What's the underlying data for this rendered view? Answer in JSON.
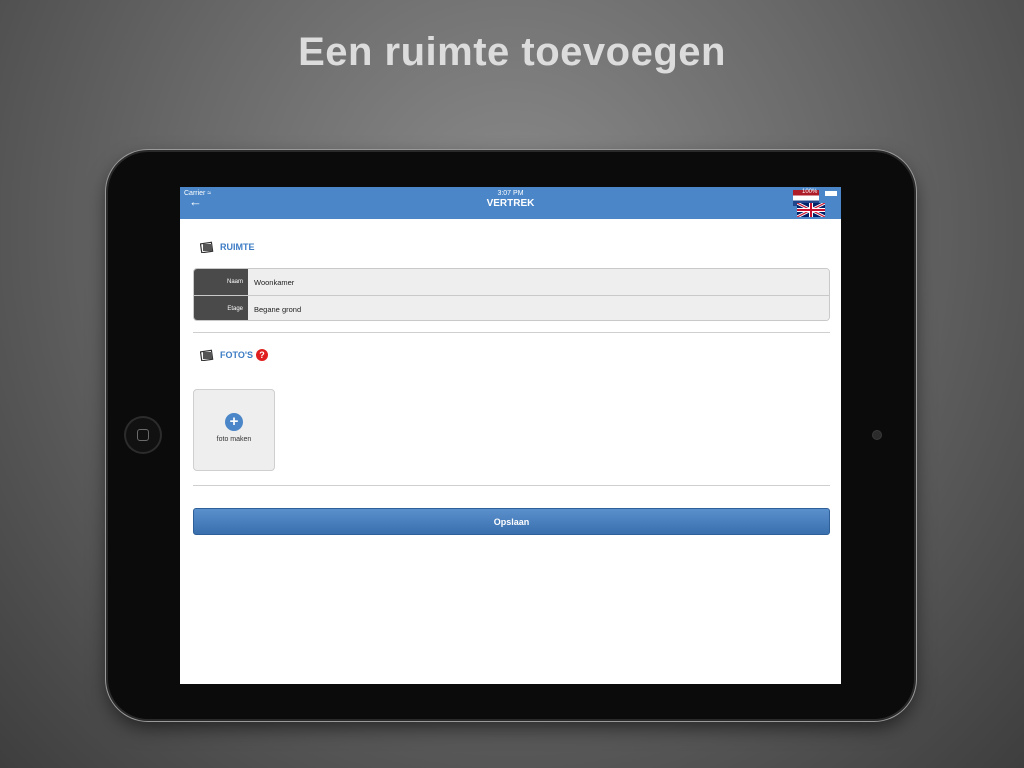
{
  "promo": {
    "headline": "Een ruimte toevoegen"
  },
  "status_bar": {
    "carrier": "Carrier",
    "time": "3:07 PM",
    "battery": "100%"
  },
  "navbar": {
    "title": "VERTREK",
    "back_icon": "back-arrow-icon",
    "language_flags": [
      "flag-nl-icon",
      "flag-uk-icon"
    ]
  },
  "ruimte": {
    "section_label": "RUIMTE",
    "fields": [
      {
        "label": "Naam",
        "value": "Woonkamer"
      },
      {
        "label": "Etage",
        "value": "Begane grond"
      }
    ]
  },
  "fotos": {
    "section_label": "FOTO'S",
    "help_symbol": "?",
    "add_photo_label": "foto maken",
    "add_icon_symbol": "+"
  },
  "actions": {
    "save_label": "Opslaan"
  },
  "colors": {
    "accent": "#4a86c8",
    "section_label": "#3d7cc4",
    "help": "#e02020",
    "field_label_bg": "#4a4a4a"
  }
}
